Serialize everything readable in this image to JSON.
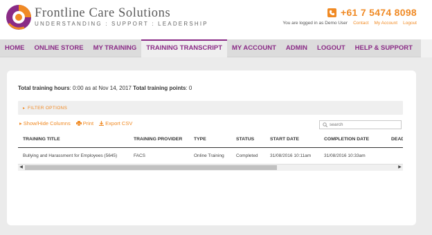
{
  "brand": {
    "name": "Frontline Care Solutions",
    "tagline": "UNDERSTANDING : SUPPORT : LEADERSHIP",
    "colors": {
      "orange": "#f08a24",
      "purple": "#8a2b86"
    }
  },
  "header": {
    "phone_icon": "phone-icon",
    "phone": "+61 7 5474 8098",
    "logged_in_text": "You are logged in as Demo User",
    "links": [
      "Contact",
      "My Account",
      "Logout"
    ]
  },
  "nav": {
    "items": [
      "HOME",
      "ONLINE STORE",
      "MY TRAINING",
      "TRAINING TRANSCRIPT",
      "MY ACCOUNT",
      "ADMIN",
      "LOGOUT",
      "HELP & SUPPORT"
    ],
    "active": "TRAINING TRANSCRIPT"
  },
  "summary": {
    "hours_label": "Total training hours",
    "hours_value": ": 0:00 as at Nov 14, 2017",
    "points_label": "Total training points",
    "points_value": ": 0"
  },
  "filter": {
    "label": "FILTER OPTIONS"
  },
  "tools": {
    "show_hide": "Show/Hide Columns",
    "print": "Print",
    "export": "Export CSV",
    "search_placeholder": "search"
  },
  "table": {
    "columns": [
      "TRAINING TITLE",
      "TRAINING PROVIDER",
      "TYPE",
      "STATUS",
      "START DATE",
      "COMPLETION DATE",
      "DEADLINE"
    ],
    "rows": [
      [
        "Bullying and Harassment for Employees (5645)",
        "FACS",
        "Online Training",
        "Completed",
        "31/08/2016 10:11am",
        "31/08/2016 10:33am",
        ""
      ]
    ]
  }
}
